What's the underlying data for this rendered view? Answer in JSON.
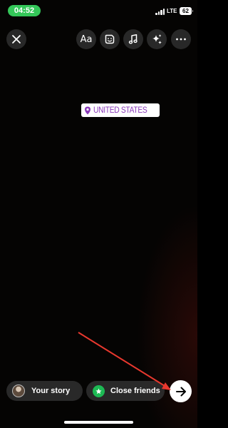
{
  "status_bar": {
    "time": "04:52",
    "network": "LTE",
    "battery": "62"
  },
  "toolbar": {
    "text_tool_label": "Aa"
  },
  "sticker": {
    "location": "UNITED STATES"
  },
  "bottom_bar": {
    "your_story_label": "Your story",
    "close_friends_label": "Close friends"
  },
  "colors": {
    "status_pill": "#34c759",
    "location_text": "#8a3ab9",
    "close_friends_badge": "#1db954",
    "annotation_arrow": "#e8382e"
  },
  "icons": {
    "close": "close-icon",
    "sticker": "sticker-icon",
    "music": "music-note-icon",
    "effects": "sparkles-icon",
    "more": "more-icon",
    "location_pin": "location-pin-icon",
    "close_friends_star": "star-icon",
    "send": "arrow-right-icon"
  }
}
